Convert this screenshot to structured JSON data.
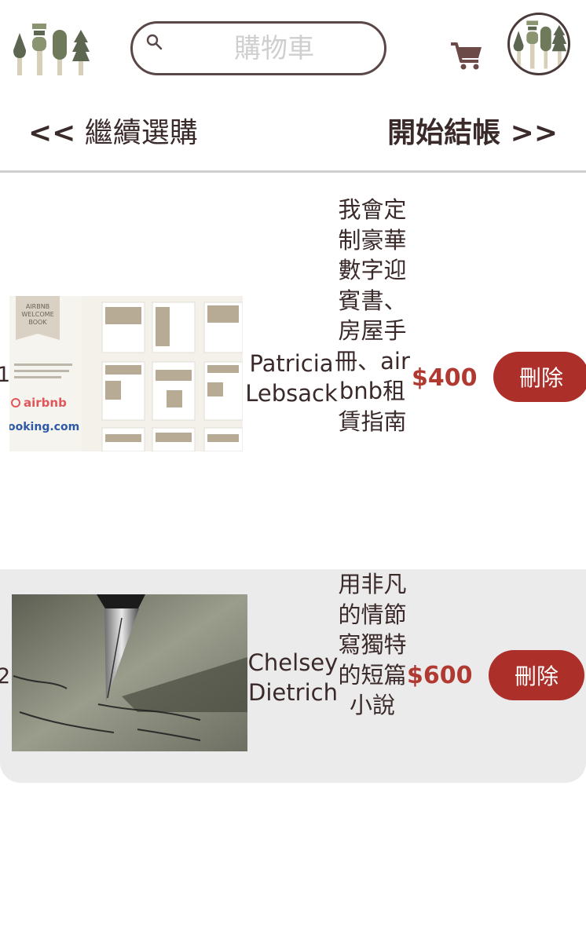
{
  "header": {
    "search": {
      "placeholder": "購物車",
      "value": ""
    }
  },
  "nav": {
    "back_arrows": "<<",
    "back_label": "繼續選購",
    "checkout_label": "開始結帳",
    "checkout_arrows": ">>"
  },
  "cart": {
    "items": [
      {
        "index": "1",
        "seller": "Patricia Lebsack",
        "description": "我會定制豪華數字迎賓書、房屋手冊、airbnb租賃指南",
        "price": "$400",
        "delete_label": "刪除",
        "thumbnail_text": {
          "title": "AIRBNB WELCOME BOOK",
          "brand1": "airbnb",
          "brand2": "ooking.com"
        }
      },
      {
        "index": "2",
        "seller": "Chelsey Dietrich",
        "description": "用非凡的情節寫獨特的短篇小說",
        "price": "$600",
        "delete_label": "刪除"
      }
    ]
  },
  "colors": {
    "accent_red": "#ad2f2a",
    "price_red": "#b03a32",
    "text_dark": "#3a2a2a",
    "tree_green": "#6f7a5a",
    "tree_trunk": "#d8cfb8",
    "row_alt_bg": "#ecebeb"
  },
  "icons": [
    "logo-trees-icon",
    "search-icon",
    "cart-icon",
    "avatar-trees-icon"
  ]
}
